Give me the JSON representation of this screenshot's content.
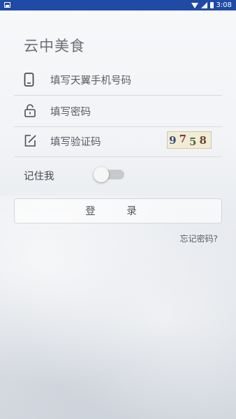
{
  "status_bar": {
    "time": "3:08"
  },
  "app_title": "云中美食",
  "form": {
    "phone_placeholder": "填写天翼手机号码",
    "password_placeholder": "填写密码",
    "captcha_placeholder": "填写验证码",
    "captcha_chars": [
      "9",
      "7",
      "5",
      "8"
    ]
  },
  "remember": {
    "label": "记住我",
    "checked": false
  },
  "login_label": "登 录",
  "forgot_label": "忘记密码?",
  "colors": {
    "status_bar": "#1f4aa6",
    "text": "#5a5d62"
  }
}
